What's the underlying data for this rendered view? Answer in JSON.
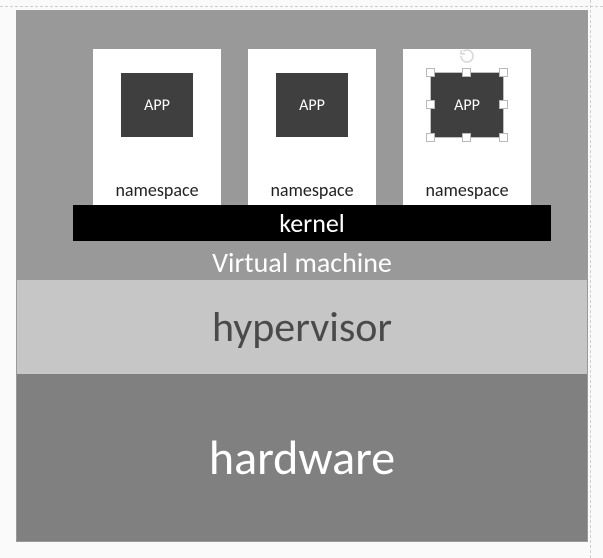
{
  "layers": {
    "vm_label": "Virtual machine",
    "kernel_label": "kernel",
    "hypervisor_label": "hypervisor",
    "hardware_label": "hardware"
  },
  "namespaces": [
    {
      "app_label": "APP",
      "ns_label": "namespace",
      "selected": false
    },
    {
      "app_label": "APP",
      "ns_label": "namespace",
      "selected": false
    },
    {
      "app_label": "APP",
      "ns_label": "namespace",
      "selected": true
    }
  ],
  "icons": {
    "rotate": "rotate-icon"
  },
  "chart_data": {
    "type": "table",
    "title": "Container/VM architecture stack",
    "stack_top_to_bottom": [
      "namespace (APP) ×3",
      "kernel",
      "Virtual machine",
      "hypervisor",
      "hardware"
    ],
    "note": "Third APP shape is in selected/edit state with resize & rotate handles"
  }
}
